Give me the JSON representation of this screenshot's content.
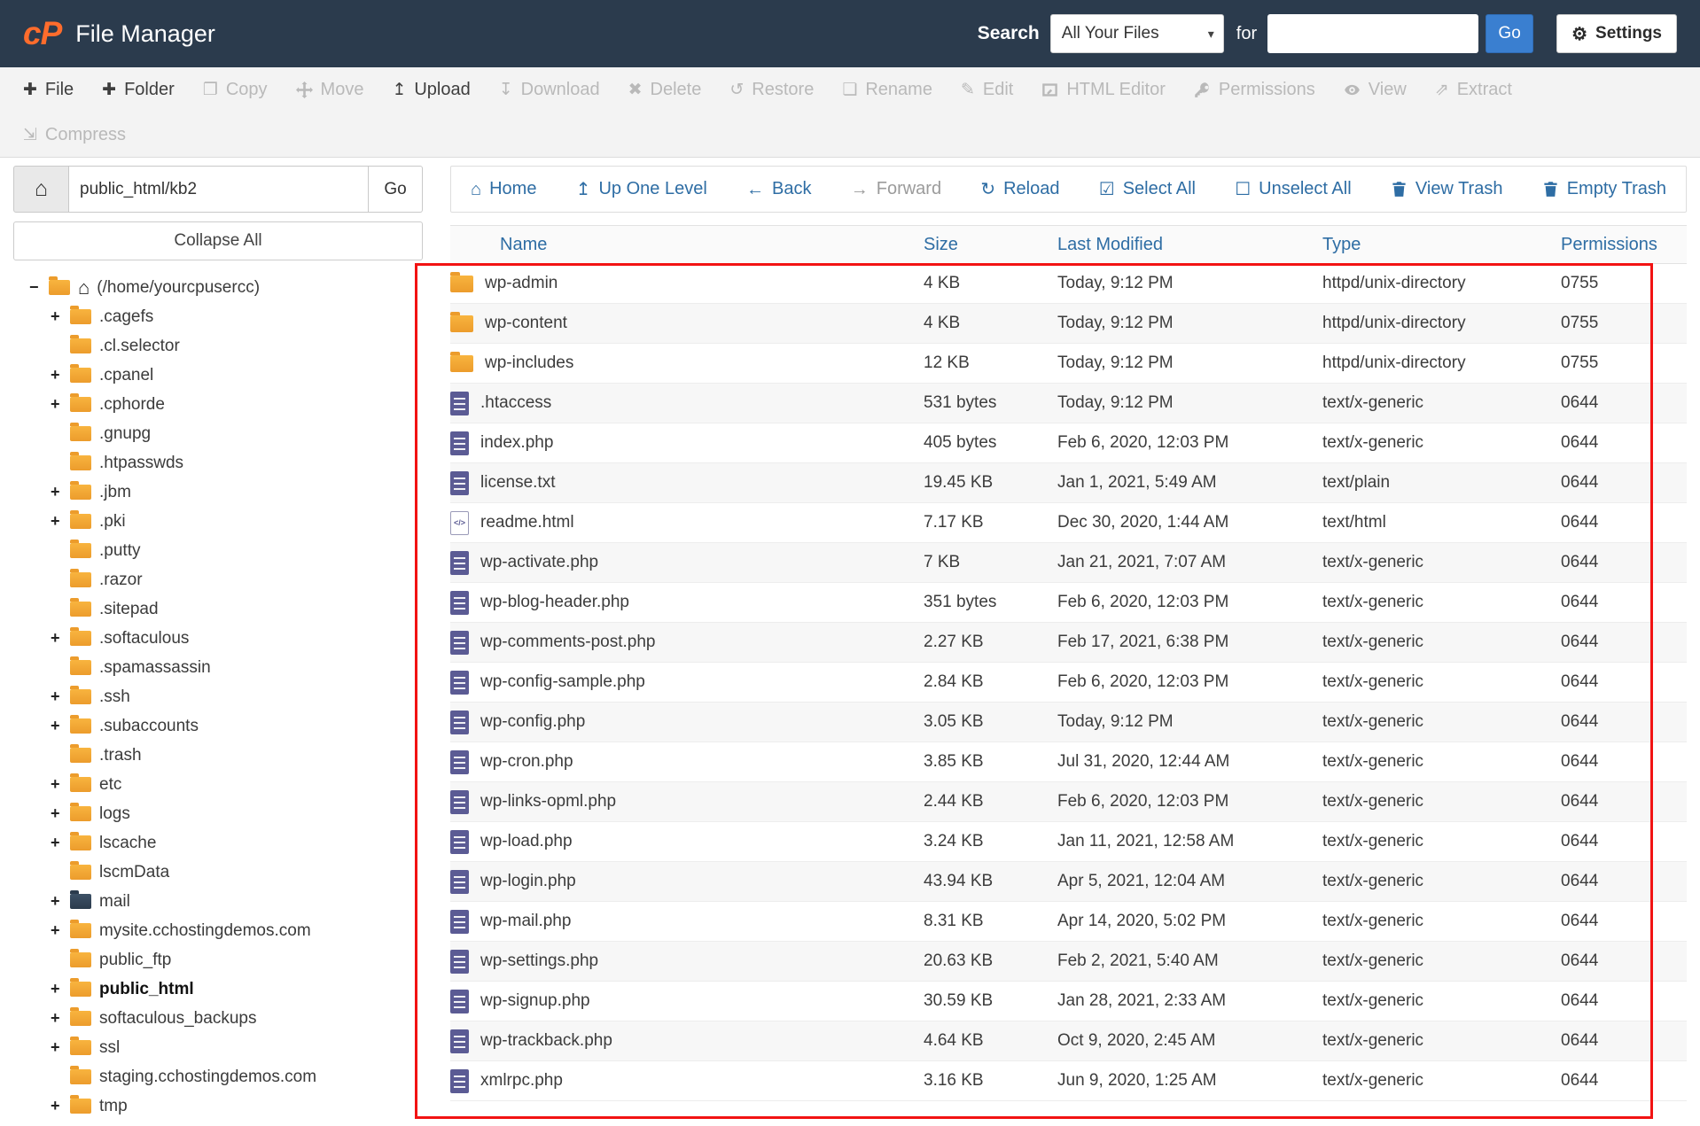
{
  "header": {
    "logo_text": "cP",
    "title": "File Manager",
    "search_label": "Search",
    "search_scope_selected": "All Your Files",
    "for_label": "for",
    "search_value": "",
    "go_label": "Go",
    "settings_label": "Settings"
  },
  "icons": {
    "caret_down": "▾",
    "gear": "⚙",
    "home": "⌂",
    "plus": "✚",
    "copy": "❐",
    "upload": "↥",
    "download": "↧",
    "delete": "✖",
    "restore": "↺",
    "rename": "❏",
    "edit": "✎",
    "extract": "⇗",
    "compress": "⇲",
    "up_one_level": "↥",
    "back": "←",
    "forward": "→",
    "reload": "↻",
    "select_all": "☑",
    "unselect_all": "☐"
  },
  "toolbar": {
    "items": [
      {
        "label": "File",
        "icon": "plus-icon",
        "enabled": true
      },
      {
        "label": "Folder",
        "icon": "plus-icon",
        "enabled": true
      },
      {
        "label": "Copy",
        "icon": "copy-icon",
        "enabled": false
      },
      {
        "label": "Move",
        "icon": "move-icon",
        "enabled": false
      },
      {
        "label": "Upload",
        "icon": "upload-icon",
        "enabled": true
      },
      {
        "label": "Download",
        "icon": "download-icon",
        "enabled": false
      },
      {
        "label": "Delete",
        "icon": "delete-icon",
        "enabled": false
      },
      {
        "label": "Restore",
        "icon": "restore-icon",
        "enabled": false
      },
      {
        "label": "Rename",
        "icon": "rename-icon",
        "enabled": false
      },
      {
        "label": "Edit",
        "icon": "pencil-icon",
        "enabled": false
      },
      {
        "label": "HTML Editor",
        "icon": "html-editor-icon",
        "enabled": false
      },
      {
        "label": "Permissions",
        "icon": "key-icon",
        "enabled": false
      },
      {
        "label": "View",
        "icon": "eye-icon",
        "enabled": false
      },
      {
        "label": "Extract",
        "icon": "extract-icon",
        "enabled": false
      },
      {
        "label": "Compress",
        "icon": "compress-icon",
        "enabled": false
      }
    ]
  },
  "sidebar": {
    "path_value": "public_html/kb2",
    "path_go_label": "Go",
    "collapse_all_label": "Collapse All",
    "tree": [
      {
        "label": "(/home/yourcpusercc)",
        "expander": "−"
      },
      {
        "label": ".cagefs",
        "expander": "+"
      },
      {
        "label": ".cl.selector",
        "expander": ""
      },
      {
        "label": ".cpanel",
        "expander": "+"
      },
      {
        "label": ".cphorde",
        "expander": "+"
      },
      {
        "label": ".gnupg",
        "expander": ""
      },
      {
        "label": ".htpasswds",
        "expander": ""
      },
      {
        "label": ".jbm",
        "expander": "+"
      },
      {
        "label": ".pki",
        "expander": "+"
      },
      {
        "label": ".putty",
        "expander": ""
      },
      {
        "label": ".razor",
        "expander": ""
      },
      {
        "label": ".sitepad",
        "expander": ""
      },
      {
        "label": ".softaculous",
        "expander": "+"
      },
      {
        "label": ".spamassassin",
        "expander": ""
      },
      {
        "label": ".ssh",
        "expander": "+"
      },
      {
        "label": ".subaccounts",
        "expander": "+"
      },
      {
        "label": ".trash",
        "expander": ""
      },
      {
        "label": "etc",
        "expander": "+"
      },
      {
        "label": "logs",
        "expander": "+"
      },
      {
        "label": "lscache",
        "expander": "+"
      },
      {
        "label": "lscmData",
        "expander": ""
      },
      {
        "label": "mail",
        "expander": "+"
      },
      {
        "label": "mysite.cchostingdemos.com",
        "expander": "+"
      },
      {
        "label": "public_ftp",
        "expander": ""
      },
      {
        "label": "public_html",
        "expander": "+"
      },
      {
        "label": "softaculous_backups",
        "expander": "+"
      },
      {
        "label": "ssl",
        "expander": "+"
      },
      {
        "label": "staging.cchostingdemos.com",
        "expander": ""
      },
      {
        "label": "tmp",
        "expander": "+"
      }
    ]
  },
  "nav": {
    "items": [
      {
        "label": "Home",
        "enabled": true
      },
      {
        "label": "Up One Level",
        "enabled": true
      },
      {
        "label": "Back",
        "enabled": true
      },
      {
        "label": "Forward",
        "enabled": false
      },
      {
        "label": "Reload",
        "enabled": true
      },
      {
        "label": "Select All",
        "enabled": true
      },
      {
        "label": "Unselect All",
        "enabled": true
      },
      {
        "label": "View Trash",
        "enabled": true
      },
      {
        "label": "Empty Trash",
        "enabled": true
      }
    ]
  },
  "files": {
    "columns": {
      "name": "Name",
      "size": "Size",
      "modified": "Last Modified",
      "type": "Type",
      "permissions": "Permissions"
    },
    "rows": [
      {
        "name": "wp-admin",
        "size": "4 KB",
        "modified": "Today, 9:12 PM",
        "type": "httpd/unix-directory",
        "permissions": "0755",
        "kind": "folder"
      },
      {
        "name": "wp-content",
        "size": "4 KB",
        "modified": "Today, 9:12 PM",
        "type": "httpd/unix-directory",
        "permissions": "0755",
        "kind": "folder"
      },
      {
        "name": "wp-includes",
        "size": "12 KB",
        "modified": "Today, 9:12 PM",
        "type": "httpd/unix-directory",
        "permissions": "0755",
        "kind": "folder"
      },
      {
        "name": ".htaccess",
        "size": "531 bytes",
        "modified": "Today, 9:12 PM",
        "type": "text/x-generic",
        "permissions": "0644",
        "kind": "file"
      },
      {
        "name": "index.php",
        "size": "405 bytes",
        "modified": "Feb 6, 2020, 12:03 PM",
        "type": "text/x-generic",
        "permissions": "0644",
        "kind": "file"
      },
      {
        "name": "license.txt",
        "size": "19.45 KB",
        "modified": "Jan 1, 2021, 5:49 AM",
        "type": "text/plain",
        "permissions": "0644",
        "kind": "file"
      },
      {
        "name": "readme.html",
        "size": "7.17 KB",
        "modified": "Dec 30, 2020, 1:44 AM",
        "type": "text/html",
        "permissions": "0644",
        "kind": "code"
      },
      {
        "name": "wp-activate.php",
        "size": "7 KB",
        "modified": "Jan 21, 2021, 7:07 AM",
        "type": "text/x-generic",
        "permissions": "0644",
        "kind": "file"
      },
      {
        "name": "wp-blog-header.php",
        "size": "351 bytes",
        "modified": "Feb 6, 2020, 12:03 PM",
        "type": "text/x-generic",
        "permissions": "0644",
        "kind": "file"
      },
      {
        "name": "wp-comments-post.php",
        "size": "2.27 KB",
        "modified": "Feb 17, 2021, 6:38 PM",
        "type": "text/x-generic",
        "permissions": "0644",
        "kind": "file"
      },
      {
        "name": "wp-config-sample.php",
        "size": "2.84 KB",
        "modified": "Feb 6, 2020, 12:03 PM",
        "type": "text/x-generic",
        "permissions": "0644",
        "kind": "file"
      },
      {
        "name": "wp-config.php",
        "size": "3.05 KB",
        "modified": "Today, 9:12 PM",
        "type": "text/x-generic",
        "permissions": "0644",
        "kind": "file"
      },
      {
        "name": "wp-cron.php",
        "size": "3.85 KB",
        "modified": "Jul 31, 2020, 12:44 AM",
        "type": "text/x-generic",
        "permissions": "0644",
        "kind": "file"
      },
      {
        "name": "wp-links-opml.php",
        "size": "2.44 KB",
        "modified": "Feb 6, 2020, 12:03 PM",
        "type": "text/x-generic",
        "permissions": "0644",
        "kind": "file"
      },
      {
        "name": "wp-load.php",
        "size": "3.24 KB",
        "modified": "Jan 11, 2021, 12:58 AM",
        "type": "text/x-generic",
        "permissions": "0644",
        "kind": "file"
      },
      {
        "name": "wp-login.php",
        "size": "43.94 KB",
        "modified": "Apr 5, 2021, 12:04 AM",
        "type": "text/x-generic",
        "permissions": "0644",
        "kind": "file"
      },
      {
        "name": "wp-mail.php",
        "size": "8.31 KB",
        "modified": "Apr 14, 2020, 5:02 PM",
        "type": "text/x-generic",
        "permissions": "0644",
        "kind": "file"
      },
      {
        "name": "wp-settings.php",
        "size": "20.63 KB",
        "modified": "Feb 2, 2021, 5:40 AM",
        "type": "text/x-generic",
        "permissions": "0644",
        "kind": "file"
      },
      {
        "name": "wp-signup.php",
        "size": "30.59 KB",
        "modified": "Jan 28, 2021, 2:33 AM",
        "type": "text/x-generic",
        "permissions": "0644",
        "kind": "file"
      },
      {
        "name": "wp-trackback.php",
        "size": "4.64 KB",
        "modified": "Oct 9, 2020, 2:45 AM",
        "type": "text/x-generic",
        "permissions": "0644",
        "kind": "file"
      },
      {
        "name": "xmlrpc.php",
        "size": "3.16 KB",
        "modified": "Jun 9, 2020, 1:25 AM",
        "type": "text/x-generic",
        "permissions": "0644",
        "kind": "file"
      }
    ]
  },
  "annotation": {
    "highlight_color": "#f21313"
  }
}
